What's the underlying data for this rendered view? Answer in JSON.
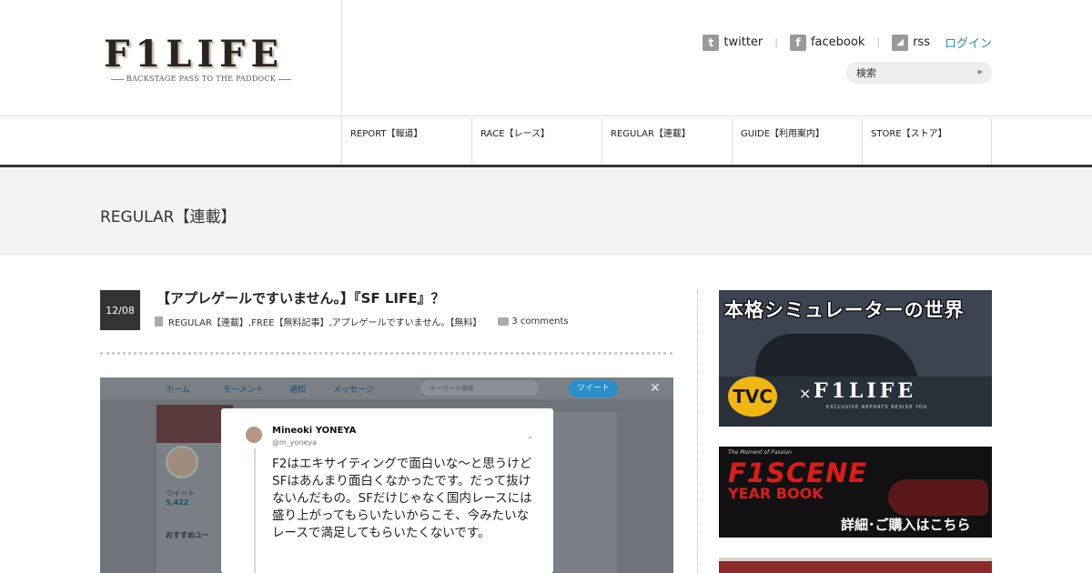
{
  "header": {
    "logo_main": "F1LIFE",
    "logo_sub": "BACKSTAGE PASS TO THE PADDOCK",
    "social": {
      "twitter": "twitter",
      "facebook": "facebook",
      "rss": "rss",
      "login": "ログイン"
    },
    "search_placeholder": "検索"
  },
  "nav": {
    "items": [
      "REPORT【報道】",
      "RACE【レース】",
      "REGULAR【連載】",
      "GUIDE【利用案内】",
      "STORE【ストア】"
    ]
  },
  "category_title": "REGULAR【連載】",
  "post": {
    "date": "12/08",
    "title": "【アプレゲールですいません。】『SF LIFE』？",
    "categories": "REGULAR【連載】,FREE【無料記事】,アプレゲールですいません。【無料】",
    "comments": "3 comments",
    "image": {
      "nav_home": "ホーム",
      "nav_moments": "モーメント",
      "nav_notifications": "通知",
      "nav_messages": "メッセージ",
      "search_placeholder": "キーワード検索",
      "tweet_button": "ツイート",
      "close": "✕",
      "profile_tweets_label": "ツイート",
      "profile_tweets_count": "5,422",
      "recommend": "おすすめユー",
      "tweet": {
        "name": "Mineoki YONEYA",
        "handle": "@m_yoneya",
        "text": "F2はエキサイティングで面白いな〜と思うけどSFはあんまり面白くなかったです。だって抜けないんだもの。SFだけじゃなく国内レースには盛り上がってもらいたいからこそ、今みたいなレースで満足してもらいたくないです。"
      }
    }
  },
  "sidebar": {
    "banner1": {
      "title": "本格シミュレーターの世界",
      "tvc": "TVC",
      "x": "×",
      "brand": "F1LIFE",
      "sub": "EXCLUSIVE REPORTS BESIDE YOU"
    },
    "banner2": {
      "top": "The Moment of Passion",
      "title": "F1SCENE",
      "yearbook": "YEAR BOOK",
      "cta": "詳細･ご購入はこちら"
    }
  },
  "colors": {
    "accent": "#2a8fa8",
    "dark": "#333333",
    "band": "#f3f3f3",
    "banner_red": "#e01a1a"
  },
  "icons": [
    "twitter-icon",
    "facebook-icon",
    "rss-icon",
    "search-arrow-icon",
    "document-icon",
    "comment-icon"
  ]
}
